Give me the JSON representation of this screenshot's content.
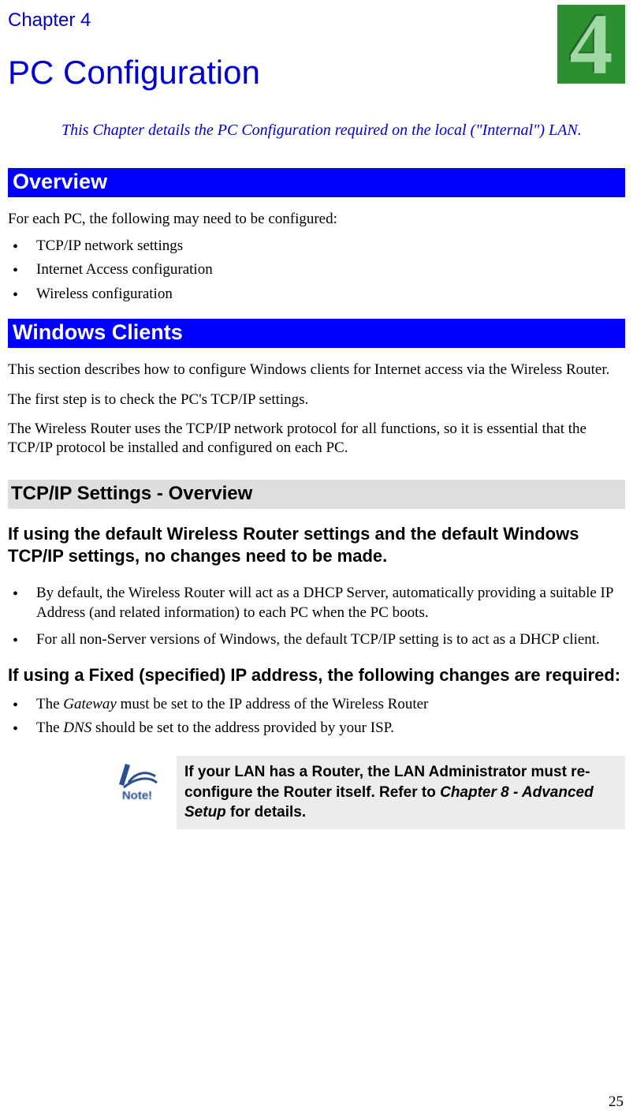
{
  "chapter": {
    "label": "Chapter 4",
    "title": "PC Configuration",
    "number": "4",
    "tagline": "This Chapter details the PC Configuration required on the local (\"Internal\") LAN."
  },
  "overview": {
    "header": "Overview",
    "intro": "For each PC, the following may need to be configured:",
    "items": [
      "TCP/IP network settings",
      "Internet Access configuration",
      "Wireless configuration"
    ]
  },
  "windows": {
    "header": "Windows Clients",
    "p1": "This section describes how to configure Windows clients for Internet access via the Wireless Router.",
    "p2": "The first step is to check the PC's TCP/IP settings.",
    "p3": "The Wireless Router uses the TCP/IP network protocol for all functions, so it is essential that the TCP/IP protocol be installed and configured on each PC."
  },
  "tcpip": {
    "header": "TCP/IP Settings - Overview",
    "default_heading": "If using the default Wireless Router settings and the default Windows TCP/IP settings, no changes need to be made.",
    "default_items": [
      "By default, the Wireless Router will act as a DHCP Server, automatically providing a suitable IP Address (and related information) to each PC when the PC boots.",
      "For all non-Server versions of Windows, the default TCP/IP setting is to act as a DHCP client."
    ],
    "fixed_heading": "If using a Fixed (specified) IP address, the following changes are required:",
    "fixed_items": {
      "gateway_pre": "The ",
      "gateway_em": "Gateway",
      "gateway_post": " must be set to the IP address of the Wireless Router",
      "dns_pre": "The ",
      "dns_em": "DNS",
      "dns_post": " should be set to the address provided by your ISP."
    }
  },
  "note": {
    "icon_label": "Note!",
    "text_pre": "If your LAN has a Router, the LAN Administrator must re-configure the Router itself. Refer to ",
    "text_ref": "Chapter 8 - Advanced Setup",
    "text_post": " for details."
  },
  "page_number": "25"
}
